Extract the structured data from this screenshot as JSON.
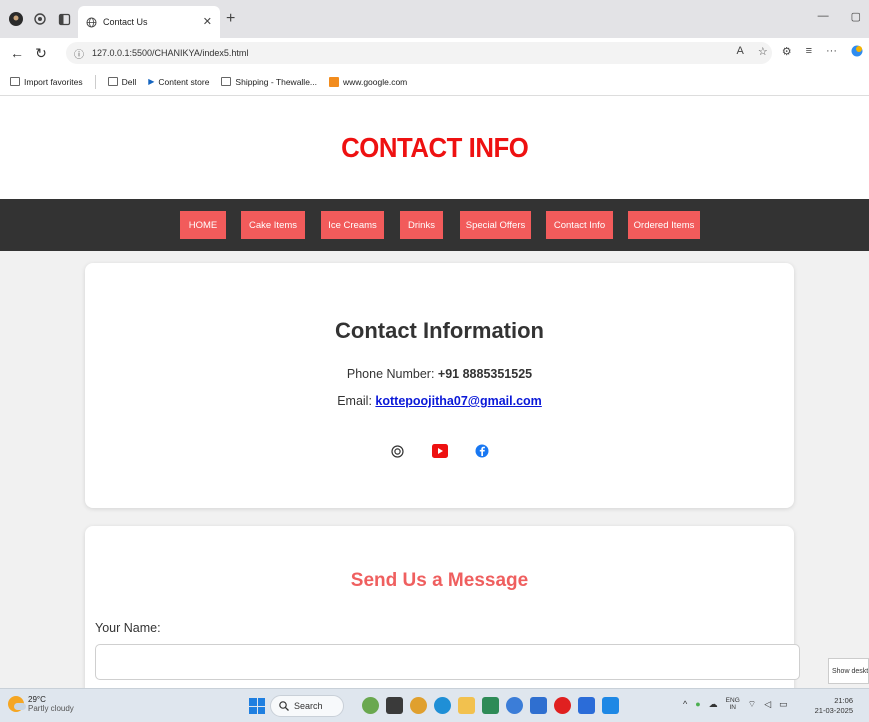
{
  "browser": {
    "tab_title": "Contact Us",
    "url": "127.0.0.1:5500/CHANIKYA/index5.html",
    "favorites": [
      "Import favorites",
      "Dell",
      "Content store",
      "Shipping - Thewalle...",
      "www.google.com"
    ]
  },
  "site": {
    "title": "CONTACT INFO",
    "nav": [
      "HOME",
      "Cake Items",
      "Ice Creams",
      "Drinks",
      "Special Offers",
      "Contact Info",
      "Ordered Items"
    ]
  },
  "contact": {
    "heading": "Contact Information",
    "phone_label": "Phone Number: ",
    "phone_value": "+91 8885351525",
    "email_label": "Email: ",
    "email_value": "kottepoojitha07@gmail.com",
    "socials": [
      "instagram-icon",
      "youtube-icon",
      "facebook-icon"
    ]
  },
  "message": {
    "heading": "Send Us a Message",
    "name_label": "Your Name:",
    "name_value": "",
    "name_placeholder": ""
  },
  "system": {
    "show_desktop": "Show deskto",
    "temperature": "29°C",
    "weather": "Partly cloudy",
    "search_label": "Search",
    "lang_top": "ENG",
    "lang_bottom": "IN",
    "time": "21:06",
    "date": "21-03-2025"
  },
  "colors": {
    "accent_red": "#ee1111",
    "nav_button": "#f25b5b",
    "nav_bar": "#333333",
    "message_heading": "#ef5f5f",
    "email_link": "#0a18d8"
  }
}
